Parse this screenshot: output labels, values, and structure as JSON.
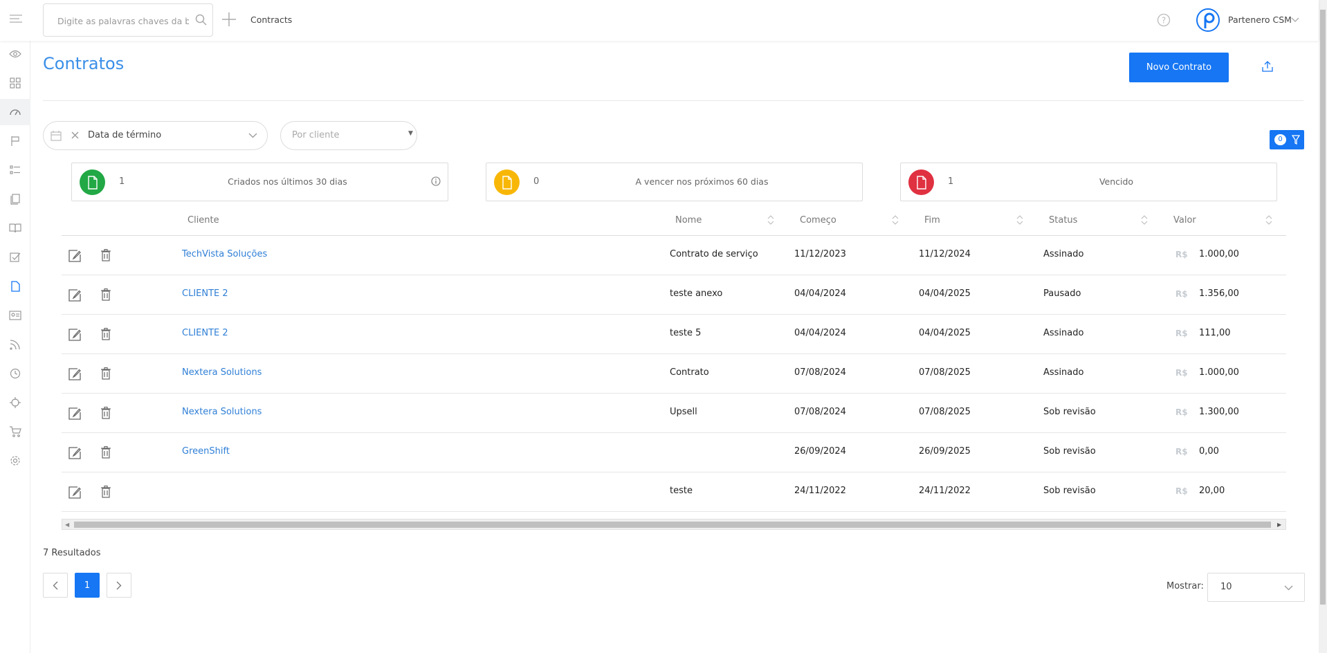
{
  "topbar": {
    "search_placeholder": "Digite as palavras chaves da busca",
    "breadcrumb": "Contracts",
    "user_name": "Partenero CSM"
  },
  "sidebar": {
    "items": [
      "eye-icon",
      "grid-icon",
      "dashboard-icon",
      "flag-icon",
      "list-icon",
      "documents-icon",
      "book-icon",
      "checklist-icon",
      "contract-icon",
      "id-card-icon",
      "rss-icon",
      "clock-icon",
      "target-icon",
      "cart-icon",
      "gear-icon"
    ],
    "active": "dashboard-icon",
    "current": "contract-icon"
  },
  "page": {
    "title": "Contratos",
    "new_button": "Novo Contrato"
  },
  "filters": {
    "date_filter": "Data de término",
    "client_placeholder": "Por cliente",
    "active_filters": "0"
  },
  "cards": [
    {
      "count": "1",
      "label": "Criados nos últimos 30 dias",
      "color": "#22a845"
    },
    {
      "count": "0",
      "label": "A vencer nos próximos 60 dias",
      "color": "#f8b707"
    },
    {
      "count": "1",
      "label": "Vencido",
      "color": "#e03141"
    }
  ],
  "table": {
    "headers": {
      "cliente": "Cliente",
      "nome": "Nome",
      "comeco": "Começo",
      "fim": "Fim",
      "status": "Status",
      "valor": "Valor"
    },
    "currency": "R$",
    "rows": [
      {
        "cliente": "TechVista Soluções",
        "nome": "Contrato de serviço",
        "comeco": "11/12/2023",
        "fim": "11/12/2024",
        "status": "Assinado",
        "valor": "1.000,00"
      },
      {
        "cliente": "CLIENTE 2",
        "nome": "teste anexo",
        "comeco": "04/04/2024",
        "fim": "04/04/2025",
        "status": "Pausado",
        "valor": "1.356,00"
      },
      {
        "cliente": "CLIENTE 2",
        "nome": "teste 5",
        "comeco": "04/04/2024",
        "fim": "04/04/2025",
        "status": "Assinado",
        "valor": "111,00"
      },
      {
        "cliente": "Nextera Solutions",
        "nome": "Contrato",
        "comeco": "07/08/2024",
        "fim": "07/08/2025",
        "status": "Assinado",
        "valor": "1.000,00"
      },
      {
        "cliente": "Nextera Solutions",
        "nome": "Upsell",
        "comeco": "07/08/2024",
        "fim": "07/08/2025",
        "status": "Sob revisão",
        "valor": "1.300,00"
      },
      {
        "cliente": "GreenShift",
        "nome": "",
        "comeco": "26/09/2024",
        "fim": "26/09/2025",
        "status": "Sob revisão",
        "valor": "0,00"
      },
      {
        "cliente": "",
        "nome": "teste",
        "comeco": "24/11/2022",
        "fim": "24/11/2022",
        "status": "Sob revisão",
        "valor": "20,00"
      }
    ]
  },
  "footer": {
    "results": "7 Resultados",
    "current_page": "1",
    "show_label": "Mostrar:",
    "show_value": "10"
  },
  "colors": {
    "accent": "#1676f3",
    "link": "#2f7fd6",
    "title": "#3a8fe8"
  }
}
